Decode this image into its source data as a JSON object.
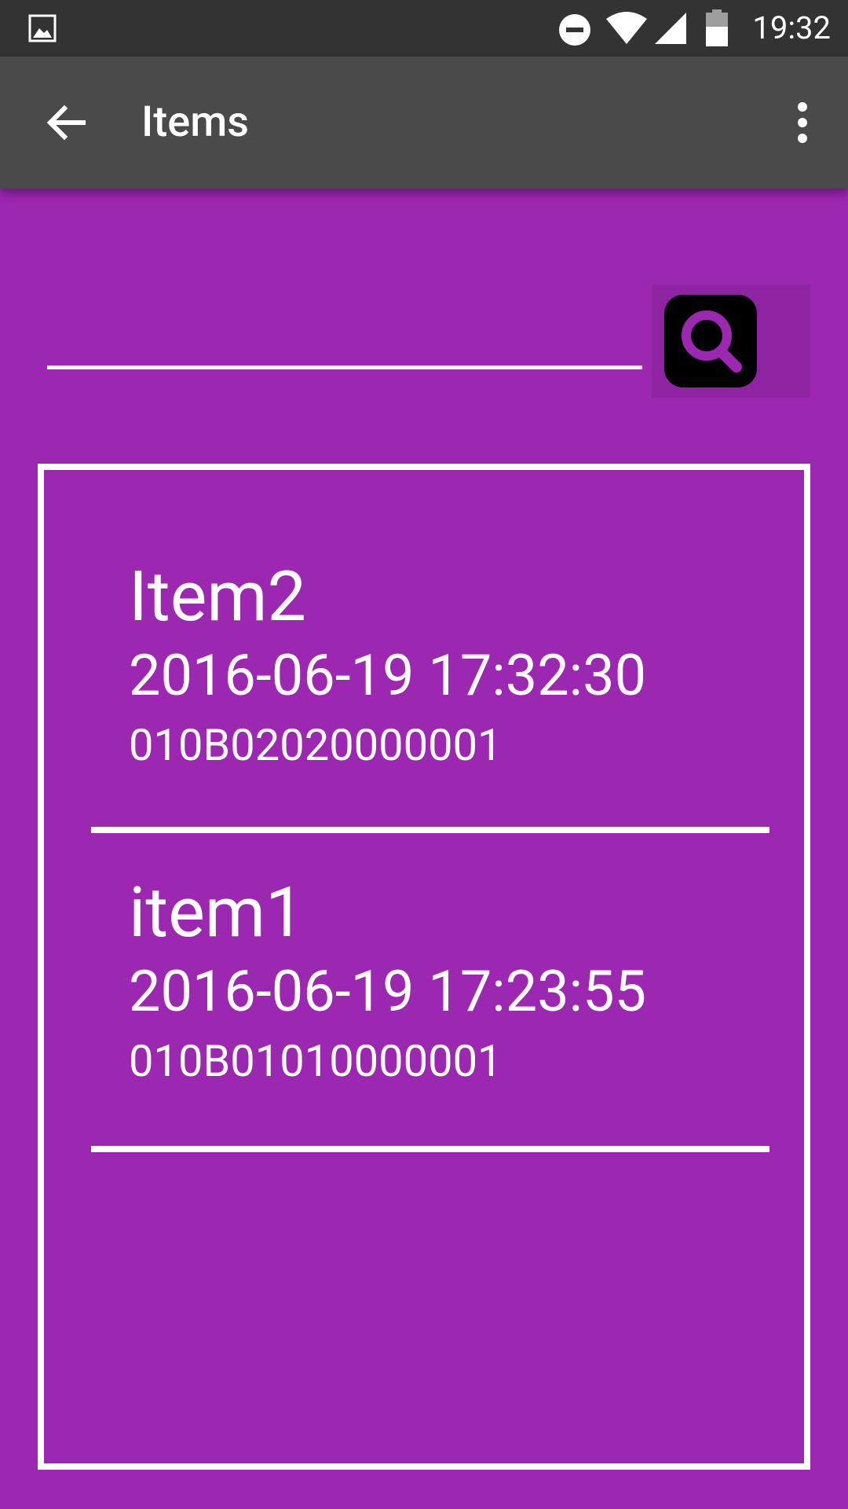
{
  "status_bar": {
    "time": "19:32",
    "icons": [
      "gallery-icon",
      "do-not-disturb-icon",
      "wifi-icon",
      "cellular-signal-icon",
      "battery-icon"
    ]
  },
  "app_bar": {
    "title": "Items",
    "back_icon": "arrow-back-icon",
    "overflow_icon": "more-vert-icon"
  },
  "search": {
    "value": "",
    "placeholder": "",
    "button_icon": "search-icon"
  },
  "items": [
    {
      "name": "Item2",
      "date": "2016-06-19 17:32:30",
      "code": "010B02020000001"
    },
    {
      "name": "item1",
      "date": "2016-06-19 17:23:55",
      "code": "010B01010000001"
    }
  ],
  "colors": {
    "background": "#9c27b0",
    "app_bar": "#4a4a4a",
    "status_bar": "#333333",
    "text": "#ffffff"
  }
}
